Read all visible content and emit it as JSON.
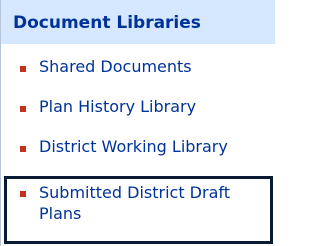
{
  "sidebar": {
    "header": {
      "title": "Document Libraries"
    },
    "items": [
      {
        "label": "Shared Documents"
      },
      {
        "label": "Plan History Library"
      },
      {
        "label": "District Working Library"
      },
      {
        "label": "Submitted District Draft Plans"
      }
    ]
  },
  "colors": {
    "header_background": "#d6e8ff",
    "link_text": "#003399",
    "bullet": "#c7301c",
    "selected_outline": "#0b1a33"
  }
}
